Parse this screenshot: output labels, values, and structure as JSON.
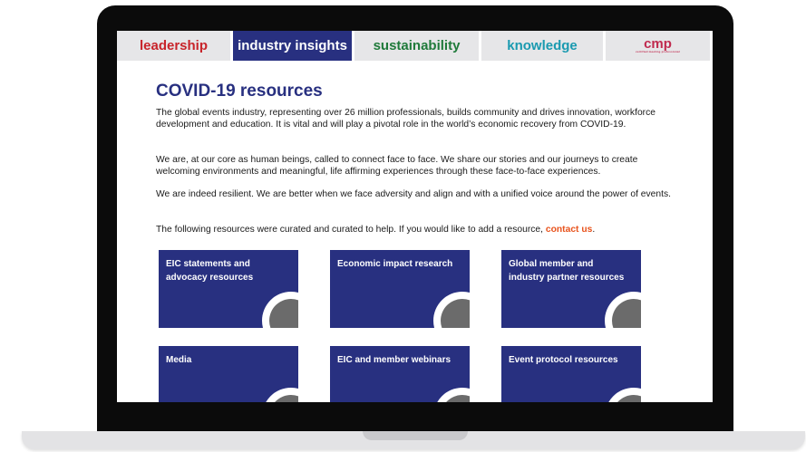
{
  "nav": {
    "tabs": [
      {
        "label": "leadership"
      },
      {
        "label": "industry insights"
      },
      {
        "label": "sustainability"
      },
      {
        "label": "knowledge"
      },
      {
        "label": "cmp",
        "sublabel": "certified meeting professional"
      }
    ],
    "active_tab": "industry insights"
  },
  "page": {
    "title": "COVID-19 resources",
    "paragraph1": "The global events industry, representing over 26 million professionals, builds community and drives innovation, workforce development and education. It is vital and will play a pivotal role in the world’s economic recovery from COVID-19.",
    "paragraph2": "We are, at our core as human beings, called to connect face to face. We share our stories and our journeys to create welcoming environments and meaningful, life affirming experiences through these face-to-face experiences.",
    "paragraph3": "We are indeed resilient. We are better when we face adversity and align and with a unified voice around the power of events.",
    "paragraph4_prefix": "The following resources were curated and curated to help. If you would like to add a resource, ",
    "paragraph4_link": "contact us",
    "paragraph4_suffix": "."
  },
  "cards": [
    {
      "label": "EIC statements and advocacy resources"
    },
    {
      "label": "Economic impact research"
    },
    {
      "label": "Global member and industry partner resources"
    },
    {
      "label": "Media"
    },
    {
      "label": "EIC and member webinars"
    },
    {
      "label": "Event protocol resources"
    }
  ],
  "colors": {
    "brand_navy": "#283080",
    "link_orange": "#e8531d",
    "leadership_red": "#c8242a",
    "sustainability_green": "#1f7a3a",
    "knowledge_teal": "#1a9ab0"
  }
}
